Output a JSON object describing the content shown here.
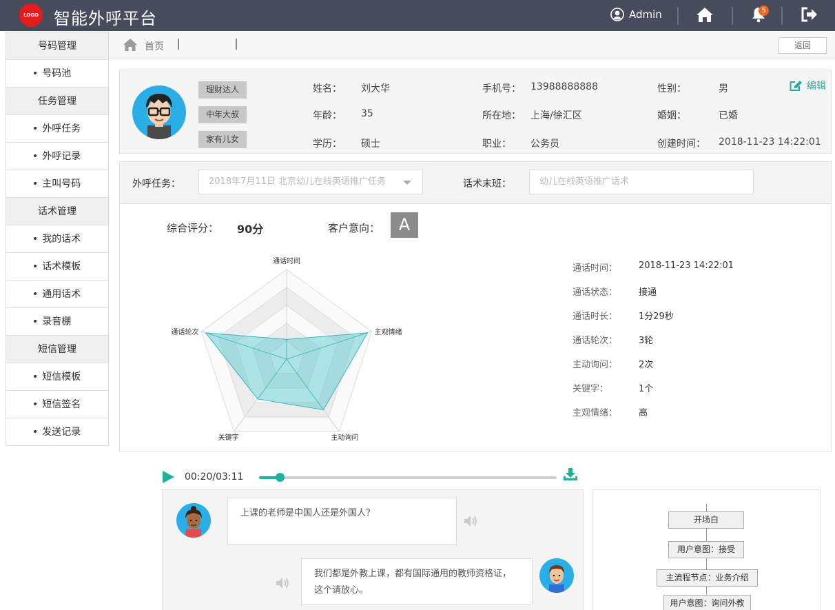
{
  "header": {
    "logo_text": "LOGO",
    "title": "智能外呼平台",
    "user": "Admin",
    "notification_count": "5",
    "icons": [
      "user-icon",
      "home-icon",
      "bell-icon",
      "logout-icon"
    ]
  },
  "sidebar": {
    "groups": [
      {
        "title": "号码管理",
        "items": [
          "号码池"
        ]
      },
      {
        "title": "任务管理",
        "items": [
          "外呼任务",
          "外呼记录",
          "主叫号码"
        ]
      },
      {
        "title": "话术管理",
        "items": [
          "我的话术",
          "话术模板",
          "通用话术",
          "录音棚"
        ]
      },
      {
        "title": "短信管理",
        "items": [
          "短信模板",
          "短信签名",
          "发送记录"
        ]
      }
    ]
  },
  "breadcrumb": {
    "home": "首页",
    "back": "返回"
  },
  "profile": {
    "tags": [
      "理财达人",
      "中年大叔",
      "家有儿女"
    ],
    "fields": [
      {
        "label": "姓名：",
        "value": "刘大华"
      },
      {
        "label": "手机号：",
        "value": "13988888888"
      },
      {
        "label": "性别：",
        "value": "男"
      },
      {
        "label": "年龄：",
        "value": "35"
      },
      {
        "label": "所在地：",
        "value": "上海/徐汇区"
      },
      {
        "label": "婚姻：",
        "value": "已婚"
      },
      {
        "label": "学历：",
        "value": "硕士"
      },
      {
        "label": "职业：",
        "value": "公务员"
      },
      {
        "label": "创建时间：",
        "value": "2018-11-23 14:22:01"
      }
    ],
    "edit": "编辑"
  },
  "task": {
    "task_label": "外呼任务：",
    "task_value": "2018年7月11日 北京幼儿在线英语推广任务",
    "script_label": "话术末班：",
    "script_placeholder": "幼儿在线英语推广话术"
  },
  "analysis": {
    "score_label": "综合评分：",
    "score": "90分",
    "intent_label": "客户意向：",
    "grade": "A",
    "radar": {
      "axes": [
        "通话时间",
        "主观情绪",
        "主动询问",
        "关键字",
        "通话轮次"
      ],
      "values": [
        0.22,
        0.95,
        0.7,
        0.55,
        0.95
      ],
      "levels": 5
    },
    "stats": [
      {
        "label": "通话时间：",
        "value": "2018-11-23 14:22:01"
      },
      {
        "label": "通话状态：",
        "value": "接通"
      },
      {
        "label": "通话时长：",
        "value": "1分29秒"
      },
      {
        "label": "通话轮次：",
        "value": "3轮"
      },
      {
        "label": "主动询问：",
        "value": "2次"
      },
      {
        "label": "关键字：",
        "value": "1个"
      },
      {
        "label": "主观情绪：",
        "value": "高"
      }
    ]
  },
  "player": {
    "time": "00:20/03:11",
    "progress_fraction": 0.07,
    "accent": "#1fb29a"
  },
  "chat": {
    "messages": [
      {
        "speaker": "customer",
        "text": "上课的老师是中国人还是外国人？"
      },
      {
        "speaker": "agent",
        "text": "我们都是外教上课，都有国际通用的教师资格证，这个请放心。"
      }
    ]
  },
  "flow": {
    "nodes": [
      "开场白",
      "用户意图：接受",
      "主流程节点：业务介绍",
      "用户意图：询问外教"
    ]
  }
}
